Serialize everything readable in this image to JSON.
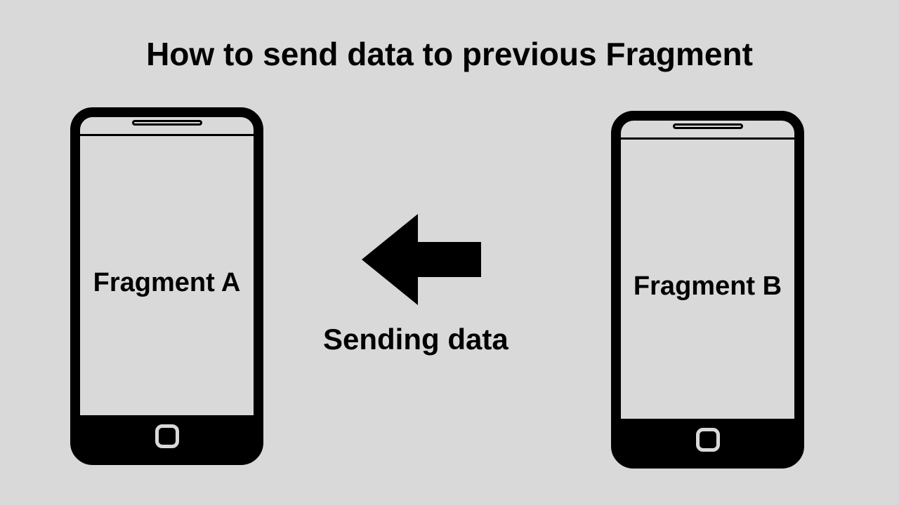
{
  "title": "How to send data to previous Fragment",
  "phoneA": {
    "label": "Fragment A"
  },
  "phoneB": {
    "label": "Fragment B"
  },
  "arrow": {
    "caption": "Sending data"
  }
}
